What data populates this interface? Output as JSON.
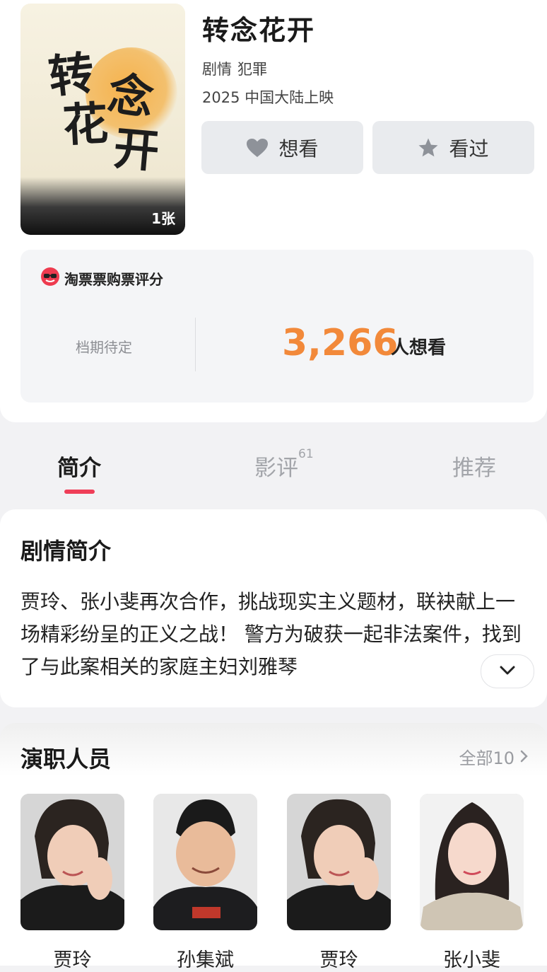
{
  "movie": {
    "title": "转念花开",
    "genres": [
      "剧情",
      "犯罪"
    ],
    "release_info": "2025 中国大陆上映",
    "poster_count": "1张",
    "poster_calligraphy": [
      "转",
      "念",
      "花",
      "开"
    ]
  },
  "actions": {
    "want_label": "想看",
    "seen_label": "看过"
  },
  "rating": {
    "source": "淘票票购票评分",
    "release_status": "档期待定",
    "want_count": "3,266",
    "want_count_label": "人想看"
  },
  "tabs": [
    {
      "label": "简介",
      "active": true,
      "badge": ""
    },
    {
      "label": "影评",
      "active": false,
      "badge": "61"
    },
    {
      "label": "推荐",
      "active": false,
      "badge": ""
    }
  ],
  "synopsis": {
    "title": "剧情简介",
    "text": "贾玲、张小斐再次合作，挑战现实主义题材，联袂献上一场精彩纷呈的正义之战！ 警方为破获一起非法案件，找到了与此案相关的家庭主妇刘雅琴"
  },
  "cast": {
    "title": "演职人员",
    "all_label": "全部10",
    "members": [
      {
        "name": "贾玲"
      },
      {
        "name": "孙集斌"
      },
      {
        "name": "贾玲"
      },
      {
        "name": "张小斐"
      }
    ]
  },
  "colors": {
    "accent_orange": "#f2893a",
    "tab_indicator": "#ef3e58",
    "button_bg": "#e9ebee"
  }
}
